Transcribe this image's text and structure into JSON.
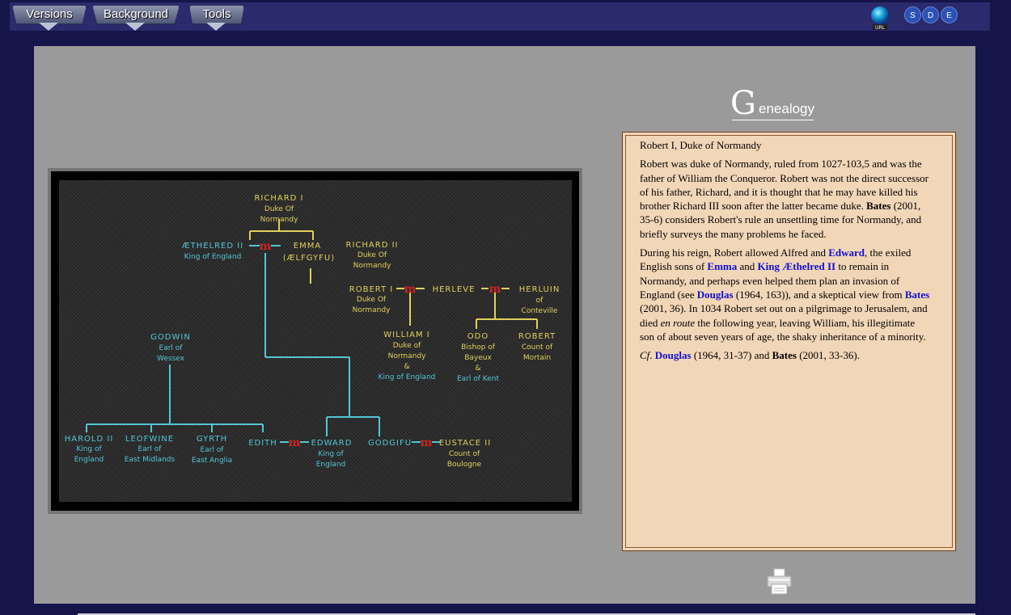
{
  "toolbar": {
    "menus": [
      {
        "label": "Versions"
      },
      {
        "label": "Background"
      },
      {
        "label": "Tools"
      }
    ],
    "url_icon_label": "URL",
    "buttons": [
      "S",
      "D",
      "E"
    ]
  },
  "tree": {
    "marriage_mark": "m",
    "people": {
      "richard1": {
        "name": "RICHARD I",
        "title1": "Duke Of",
        "title2": "Normandy"
      },
      "aethelred": {
        "name": "ÆTHELRED II",
        "title1": "King of England"
      },
      "emma": {
        "name": "EMMA",
        "title1": "(ÆLFGYFU)"
      },
      "richard2": {
        "name": "RICHARD II",
        "title1": "Duke Of",
        "title2": "Normandy"
      },
      "robert1": {
        "name": "ROBERT I",
        "title1": "Duke Of",
        "title2": "Normandy"
      },
      "herleve": {
        "name": "HERLEVE"
      },
      "herluin": {
        "name": "HERLUIN",
        "title1": "of",
        "title2": "Conteville"
      },
      "william": {
        "name": "WILLIAM I",
        "title1": "Duke of",
        "title2": "Normandy",
        "title3": "&",
        "title4": "King of England"
      },
      "odo": {
        "name": "ODO",
        "title1": "Bishop of",
        "title2": "Bayeux",
        "title3": "&",
        "title4": "Earl of Kent"
      },
      "robert_mortain": {
        "name": "ROBERT",
        "title1": "Count of",
        "title2": "Mortain"
      },
      "godwin": {
        "name": "GODWIN",
        "title1": "Earl of",
        "title2": "Wessex"
      },
      "harold": {
        "name": "HAROLD II",
        "title1": "King of",
        "title2": "England"
      },
      "leofwine": {
        "name": "LEOFWINE",
        "title1": "Earl of",
        "title2": "East Midlands"
      },
      "gyrth": {
        "name": "GYRTH",
        "title1": "Earl of",
        "title2": "East Anglia"
      },
      "edith": {
        "name": "EDITH"
      },
      "edward": {
        "name": "EDWARD",
        "title1": "King of",
        "title2": "England"
      },
      "godgifu": {
        "name": "GODGIFU"
      },
      "eustace": {
        "name": "EUSTACE II",
        "title1": "Count of",
        "title2": "Boulogne"
      }
    }
  },
  "genealogy": {
    "title_initial": "G",
    "title_rest": "enealogy",
    "heading": "Robert I, Duke of Normandy",
    "p1": {
      "text1": "Robert was duke of Normandy, ruled from 1027-103,5 and was the father of William the Conqueror. Robert was not the direct successor of his father, Richard, and it is thought that he may have killed his brother Richard III soon after the latter became duke. ",
      "bates": "Bates",
      "text2": " (2001, 35-6) considers Robert's rule an unsettling time for Normandy, and briefly surveys the many problems he faced."
    },
    "p2": {
      "t1": "During his reign, Robert allowed Alfred and ",
      "edward": "Edward",
      "t2": ", the exiled English sons of ",
      "emma": "Emma",
      "t3": " and ",
      "aethelred": "King Æthelred II",
      "t4": " to remain in Normandy, and perhaps even helped them plan an invasion of England (see ",
      "douglas": "Douglas",
      "t5": " (1964, 163)), and a skeptical view from ",
      "bates": "Bates",
      "t6": " (2001, 36). In 1034 Robert set out on a pilgrimage to Jerusalem, and died ",
      "enroute": "en route",
      "t7": " the following year, leaving William, his illegitimate son of about seven years of age, the shaky inheritance of a minority."
    },
    "p3": {
      "cf": "Cf",
      "dot": ". ",
      "douglas": "Douglas",
      "t1": " (1964, 31-37) and ",
      "bates": "Bates",
      "t2": " (2001, 33-36)."
    }
  }
}
